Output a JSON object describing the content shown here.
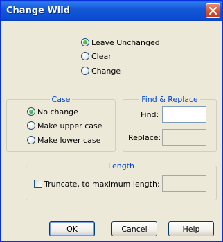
{
  "window": {
    "title": "Change Wild"
  },
  "wild_options": [
    {
      "label": "Leave Unchanged",
      "checked": true
    },
    {
      "label": "Clear",
      "checked": false
    },
    {
      "label": "Change",
      "checked": false
    }
  ],
  "case_group": {
    "legend": "Case",
    "options": [
      {
        "label": "No change",
        "checked": true
      },
      {
        "label": "Make upper case",
        "checked": false
      },
      {
        "label": "Make lower case",
        "checked": false
      }
    ]
  },
  "find_replace": {
    "legend": "Find & Replace",
    "find_label": "Find:",
    "find_value": "",
    "replace_label": "Replace:",
    "replace_value": ""
  },
  "length_group": {
    "legend": "Length",
    "truncate_label": "Truncate, to maximum length:",
    "truncate_checked": false,
    "max_length_value": ""
  },
  "buttons": {
    "ok": "OK",
    "cancel": "Cancel",
    "help": "Help"
  }
}
